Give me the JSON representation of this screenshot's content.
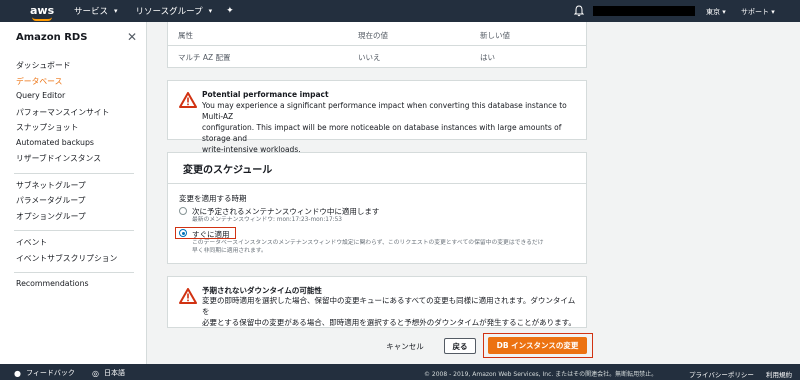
{
  "header": {
    "logo_text": "aws",
    "services_label": "サービス",
    "resource_groups_label": "リソースグループ",
    "region_label": "東京",
    "support_label": "サポート"
  },
  "sidebar": {
    "title": "Amazon RDS",
    "groups": [
      [
        {
          "label": "ダッシュボード",
          "active": false
        },
        {
          "label": "データベース",
          "active": true
        },
        {
          "label": "Query Editor",
          "active": false
        },
        {
          "label": "パフォーマンスインサイト",
          "active": false
        },
        {
          "label": "スナップショット",
          "active": false
        },
        {
          "label": "Automated backups",
          "active": false
        },
        {
          "label": "リザーブドインスタンス",
          "active": false
        }
      ],
      [
        {
          "label": "サブネットグループ",
          "active": false
        },
        {
          "label": "パラメータグループ",
          "active": false
        },
        {
          "label": "オプショングループ",
          "active": false
        }
      ],
      [
        {
          "label": "イベント",
          "active": false
        },
        {
          "label": "イベントサブスクリプション",
          "active": false
        }
      ],
      [
        {
          "label": "Recommendations",
          "active": false
        }
      ]
    ]
  },
  "changes_table": {
    "headers": [
      "属性",
      "現在の値",
      "新しい値"
    ],
    "rows": [
      [
        "マルチ AZ 配置",
        "いいえ",
        "はい"
      ]
    ]
  },
  "perf_notice": {
    "title": "Potential performance impact",
    "lines": [
      "You may experience a significant performance impact when converting this database instance to Multi-AZ",
      "configuration. This impact will be more noticeable on database instances with large amounts of storage and",
      "write-intensive workloads."
    ]
  },
  "schedule": {
    "title": "変更のスケジュール",
    "when_label": "変更を適用する時期",
    "option_next": "次に予定されるメンテナンスウィンドウ中に適用します",
    "option_next_hint": "最新のメンテナンスウィンドウ: mon:17:23-mon:17:53",
    "option_now": "すぐに適用",
    "option_now_hint_1": "このデータベースインスタンスのメンテナンスウィンドウ設定に関わらず、このリクエストの変更とすべての保留中の変更はできるだけ",
    "option_now_hint_2": "早く非同期に適用されます。"
  },
  "downtime_notice": {
    "title": "予期されないダウンタイムの可能性",
    "lines": [
      "変更の即時適用を選択した場合、保留中の変更キューにあるすべての変更も同様に適用されます。ダウンタイムを",
      "必要とする保留中の変更がある場合、即時適用を選択すると予想外のダウンタイムが発生することがあります。"
    ]
  },
  "actions": {
    "cancel_label": "キャンセル",
    "back_label": "戻る",
    "submit_label": "DB インスタンスの変更"
  },
  "footer": {
    "feedback_label": "フィードバック",
    "language_label": "日本語",
    "copyright": "© 2008 - 2019, Amazon Web Services, Inc. またはその関連会社。無断転用禁止。",
    "privacy_label": "プライバシーポリシー",
    "terms_label": "利用規約"
  },
  "colors": {
    "nav_bg": "#232f3e",
    "accent": "#ec7211",
    "warning": "#d13212",
    "selected_radio": "#0073bb"
  }
}
